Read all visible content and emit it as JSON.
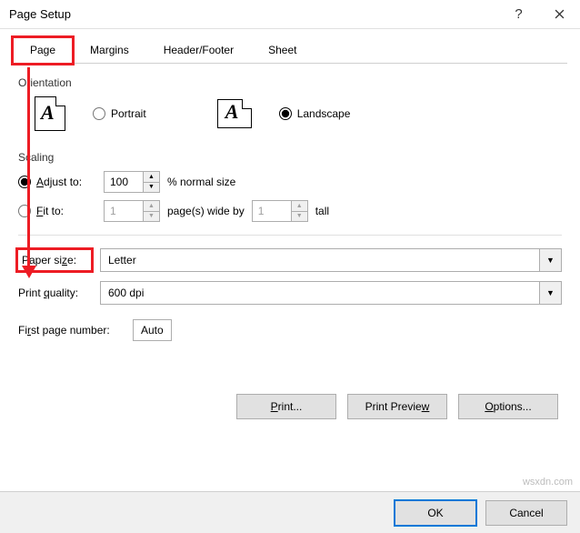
{
  "window": {
    "title": "Page Setup",
    "help": "?",
    "close": "×"
  },
  "tabs": {
    "page": "Page",
    "margins": "Margins",
    "headerfooter": "Header/Footer",
    "sheet": "Sheet"
  },
  "orientation": {
    "label": "Orientation",
    "portrait": "Portrait",
    "landscape": "Landscape",
    "selected": "landscape"
  },
  "scaling": {
    "label": "Scaling",
    "adjust": "Adjust to:",
    "adjust_value": "100",
    "adjust_unit": "% normal size",
    "fit": "Fit to:",
    "fit_wide": "1",
    "fit_wide_label": "page(s) wide by",
    "fit_tall": "1",
    "fit_tall_label": "tall"
  },
  "paper": {
    "label": "Paper size:",
    "value": "Letter"
  },
  "quality": {
    "label": "Print quality:",
    "value": "600 dpi"
  },
  "first_page": {
    "label": "First page number:",
    "value": "Auto"
  },
  "buttons": {
    "print": "Print...",
    "preview": "Print Preview",
    "options": "Options...",
    "ok": "OK",
    "cancel": "Cancel"
  },
  "watermark": "wsxdn.com"
}
